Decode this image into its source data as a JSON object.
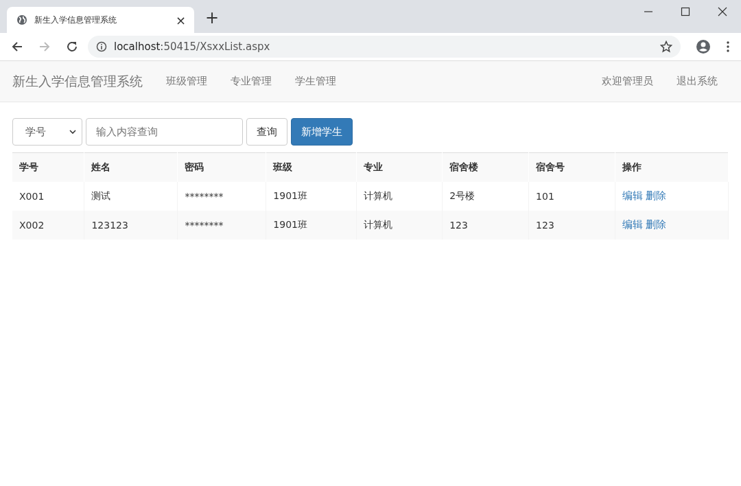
{
  "browser": {
    "tab_title": "新生入学信息管理系统",
    "close_tab": "×",
    "new_tab": "+",
    "url_host": "localhost",
    "url_rest": ":50415/XsxxList.aspx"
  },
  "navbar": {
    "brand": "新生入学信息管理系统",
    "items": [
      "班级管理",
      "专业管理",
      "学生管理"
    ],
    "right_items": [
      "欢迎管理员",
      "退出系统"
    ]
  },
  "search": {
    "field": "学号",
    "placeholder": "输入内容查询",
    "query_button": "查询",
    "add_button": "新增学生"
  },
  "table": {
    "columns": [
      "学号",
      "姓名",
      "密码",
      "班级",
      "专业",
      "宿舍楼",
      "宿舍号",
      "操作"
    ],
    "rows": [
      {
        "cells": [
          "X001",
          "测试",
          "********",
          "1901班",
          "计算机",
          "2号楼",
          "101"
        ],
        "actions": [
          "编辑",
          "删除"
        ]
      },
      {
        "cells": [
          "X002",
          "123123",
          "********",
          "1901班",
          "计算机",
          "123",
          "123"
        ],
        "actions": [
          "编辑",
          "删除"
        ]
      }
    ]
  }
}
